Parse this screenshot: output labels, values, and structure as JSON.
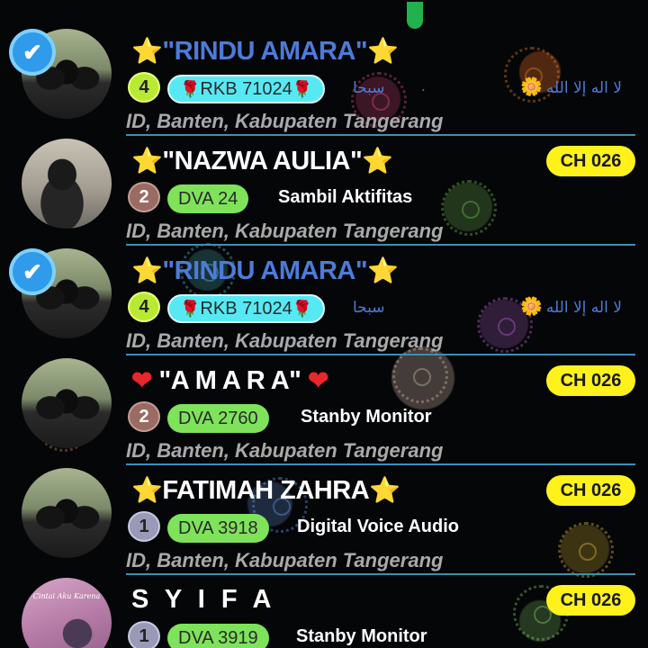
{
  "colors": {
    "background": "#050608",
    "name_blue": "#4d7bd8",
    "star_yellow": "#ffd21e",
    "rkb_pill": "#56e9f4",
    "dva_pill": "#7ee35a",
    "ch_badge": "#fff21a",
    "divider": "#3b8fb8",
    "location_gray": "#a9a9a9"
  },
  "list": [
    {
      "name": "\"RINDU AMARA\"",
      "name_prefix": "⭐",
      "name_suffix": "⭐",
      "verified": true,
      "level": "4",
      "tag": "RKB 71024",
      "tag_icons": "rose-icon",
      "arabic_mid": "سبحا",
      "arabic_dot": ".",
      "arabic_end": "لا اله إلا الله",
      "location": "ID, Banten, Kabupaten Tangerang",
      "channel": ""
    },
    {
      "name": "\"NAZWA AULIA\"",
      "name_prefix": "⭐",
      "name_suffix": "⭐",
      "verified": false,
      "level": "2",
      "tag": "DVA 24",
      "status": "Sambil Aktifitas",
      "location": "ID, Banten, Kabupaten Tangerang",
      "channel": "CH 026"
    },
    {
      "name": "\"RINDU AMARA\"",
      "name_prefix": "⭐",
      "name_suffix": "⭐",
      "verified": true,
      "level": "4",
      "tag": "RKB 71024",
      "arabic_mid": "سبحا",
      "arabic_end": "لا اله إلا الله",
      "location": "ID, Banten, Kabupaten Tangerang",
      "channel": ""
    },
    {
      "name": "\"A M A R A\"",
      "name_prefix": "❤",
      "name_suffix": "❤",
      "verified": false,
      "level": "2",
      "tag": "DVA 2760",
      "status": "Stanby Monitor",
      "location": "ID, Banten, Kabupaten Tangerang",
      "channel": "CH 026"
    },
    {
      "name": "FATIMAH ZAHRA",
      "name_prefix": "⭐",
      "name_suffix": "⭐",
      "verified": false,
      "level": "1",
      "tag": "DVA 3918",
      "status": "Digital Voice Audio",
      "location": "ID, Banten, Kabupaten Tangerang",
      "channel": "CH 026"
    },
    {
      "name": "S Y I F A",
      "verified": false,
      "level": "1",
      "tag": "DVA 3919",
      "status": "Stanby Monitor",
      "avatar_caption": "Cintai Aku Karena",
      "channel": "CH 026"
    }
  ],
  "icons": {
    "verified": "✔",
    "rose": "🌹",
    "sun": "🌼",
    "mic": "mic-icon"
  }
}
